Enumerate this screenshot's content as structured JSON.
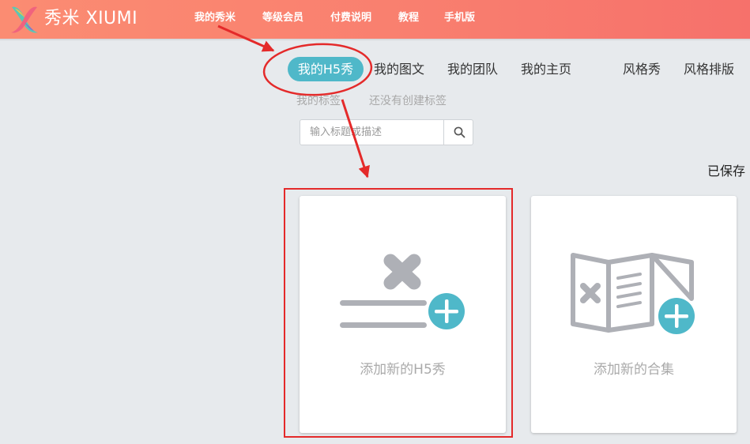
{
  "header": {
    "logo_text": "秀米 XIUMI",
    "nav": [
      {
        "label": "我的秀米"
      },
      {
        "label": "等级会员"
      },
      {
        "label": "付费说明"
      },
      {
        "label": "教程"
      },
      {
        "label": "手机版"
      }
    ]
  },
  "subnav": {
    "tabs": [
      {
        "label": "我的H5秀",
        "active": true
      },
      {
        "label": "我的图文"
      },
      {
        "label": "我的团队"
      },
      {
        "label": "我的主页"
      },
      {
        "label": "风格秀"
      },
      {
        "label": "风格排版"
      }
    ]
  },
  "tags": {
    "label": "我的标签",
    "empty_text": "还没有创建标签"
  },
  "search": {
    "placeholder": "输入标题或描述"
  },
  "status": {
    "saved_text": "已保存"
  },
  "cards": [
    {
      "label": "添加新的H5秀",
      "icon": "add-h5-icon"
    },
    {
      "label": "添加新的合集",
      "icon": "add-collection-icon"
    }
  ],
  "colors": {
    "header_gradient_start": "#fb8c72",
    "header_gradient_end": "#f6716b",
    "active_tab": "#4fb8c9",
    "plus_badge": "#4fb8c9",
    "annotation_red": "#e42a2a"
  }
}
